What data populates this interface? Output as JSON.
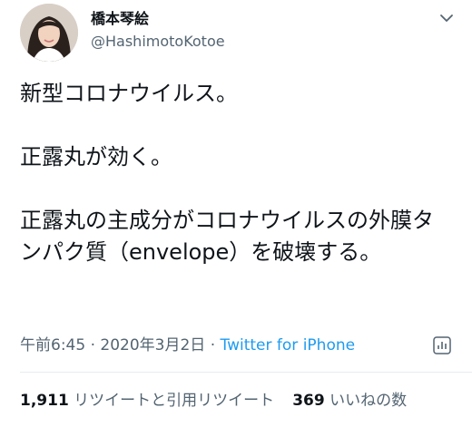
{
  "tweet": {
    "display_name": "橋本琴絵",
    "handle": "@HashimotoKotoe",
    "text": "新型コロナウイルス。\n\n正露丸が効く。\n\n正露丸の主成分がコロナウイルスの外膜タンパク質（envelope）を破壊する。",
    "time": "午前6:45",
    "separator": " · ",
    "date": "2020年3月2日",
    "separator2": " · ",
    "source": "Twitter for iPhone"
  },
  "stats": {
    "retweets_count": "1,911",
    "retweets_label": " リツイートと引用リツイート",
    "likes_count": "369",
    "likes_label": " いいねの数"
  },
  "colors": {
    "text": "#0f1419",
    "secondary": "#536471",
    "link": "#1d9bf0"
  },
  "icons": {
    "menu": "chevron-down-icon",
    "analytics": "analytics-icon"
  }
}
